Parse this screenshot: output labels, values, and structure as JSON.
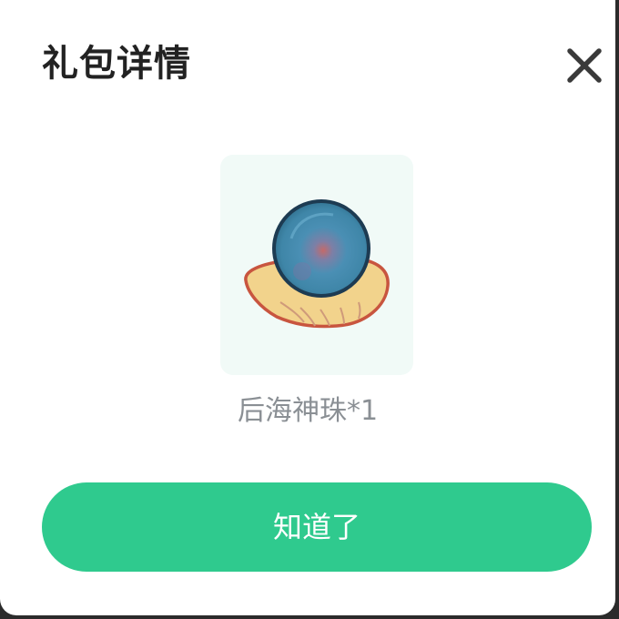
{
  "dialog": {
    "title": "礼包详情",
    "close_icon": "close-icon",
    "item": {
      "icon": "pearl-on-shell-icon",
      "name": "后海神珠*1"
    },
    "confirm_label": "知道了"
  },
  "colors": {
    "accent": "#2fca8e",
    "title": "#222222",
    "item_name": "#8a8f94",
    "card_bg": "#f1faf7"
  }
}
